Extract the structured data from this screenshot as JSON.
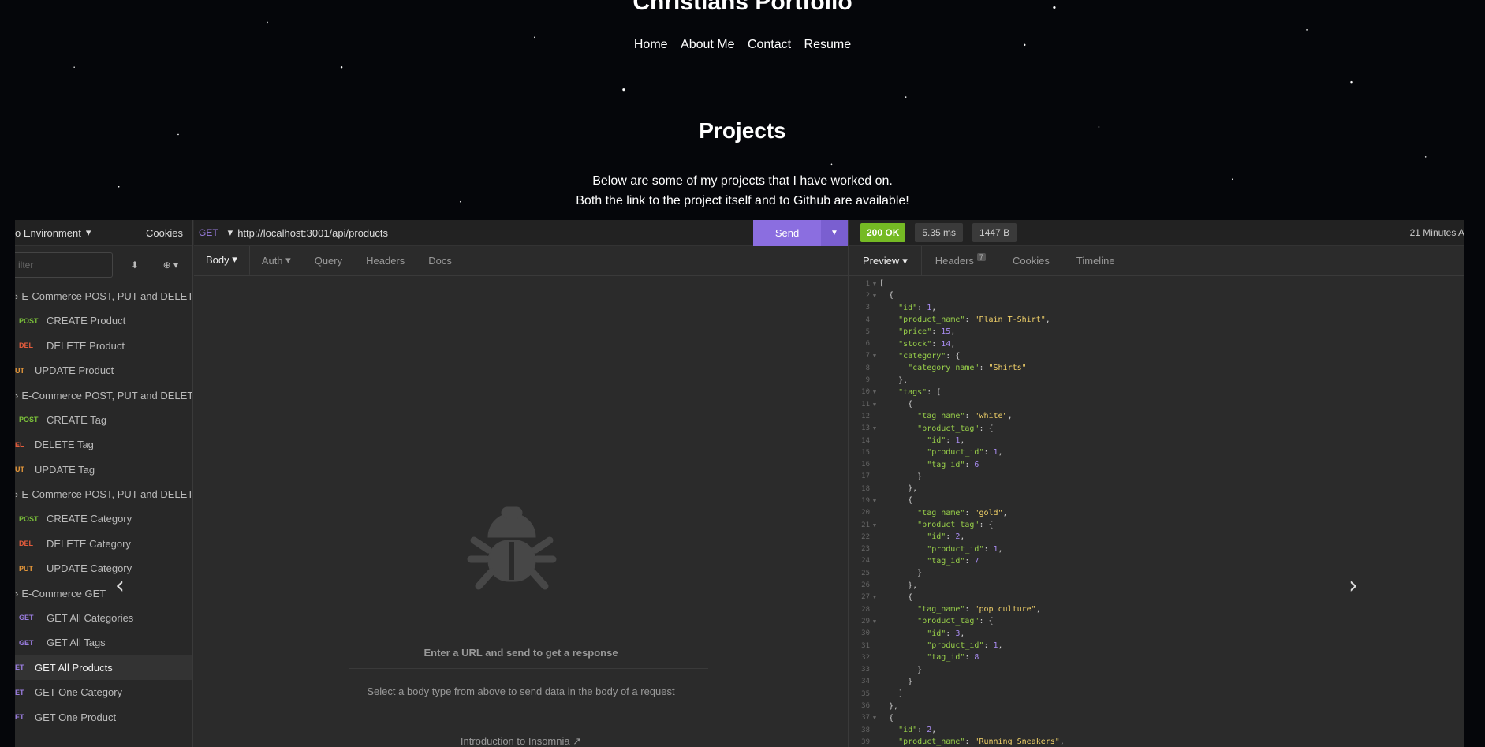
{
  "site": {
    "title": "Christians Portfolio",
    "nav": [
      "Home",
      "About Me",
      "Contact",
      "Resume"
    ],
    "projects_heading": "Projects",
    "desc_line1": "Below are some of my projects that I have worked on.",
    "desc_line2": "Both the link to the project itself and to Github are available!"
  },
  "sidebar": {
    "environment": "o Environment",
    "cookies": "Cookies",
    "filter_placeholder": "ilter",
    "items": [
      {
        "type": "folder",
        "label": "E-Commerce POST, PUT and DELETE..."
      },
      {
        "type": "req",
        "method": "POST",
        "label": "CREATE Product"
      },
      {
        "type": "req",
        "method": "DEL",
        "label": "DELETE Product"
      },
      {
        "type": "req",
        "method": "UT",
        "label": "UPDATE Product",
        "trunc": true
      },
      {
        "type": "folder",
        "label": "E-Commerce POST, PUT and DELETE..."
      },
      {
        "type": "req",
        "method": "POST",
        "label": "CREATE Tag"
      },
      {
        "type": "req",
        "method": "EL",
        "label": "DELETE Tag",
        "trunc": true
      },
      {
        "type": "req",
        "method": "UT",
        "label": "UPDATE Tag",
        "trunc": true
      },
      {
        "type": "folder",
        "label": "E-Commerce POST, PUT and DELETE..."
      },
      {
        "type": "req",
        "method": "POST",
        "label": "CREATE Category"
      },
      {
        "type": "req",
        "method": "DEL",
        "label": "DELETE Category"
      },
      {
        "type": "req",
        "method": "PUT",
        "label": "UPDATE Category"
      },
      {
        "type": "folder",
        "label": "E-Commerce GET"
      },
      {
        "type": "req",
        "method": "GET",
        "label": "GET All Categories"
      },
      {
        "type": "req",
        "method": "GET",
        "label": "GET All Tags"
      },
      {
        "type": "req",
        "method": "ET",
        "label": "GET All Products",
        "trunc": true,
        "active": true
      },
      {
        "type": "req",
        "method": "ET",
        "label": "GET One Category",
        "trunc": true
      },
      {
        "type": "req",
        "method": "ET",
        "label": "GET One Product",
        "trunc": true
      }
    ]
  },
  "request": {
    "method": "GET",
    "url": "http://localhost:3001/api/products",
    "send": "Send",
    "tabs": [
      "Body",
      "Auth",
      "Query",
      "Headers",
      "Docs"
    ],
    "empty_title": "Enter a URL and send to get a response",
    "empty_sub": "Select a body type from above to send data in the body of a request",
    "intro_link": "Introduction to Insomnia"
  },
  "response": {
    "status": "200 OK",
    "time": "5.35 ms",
    "size": "1447 B",
    "age": "21 Minutes A",
    "tabs": [
      "Preview",
      "Headers",
      "Cookies",
      "Timeline"
    ],
    "headers_count": "7",
    "lines": [
      [
        {
          "t": "p",
          "v": "["
        }
      ],
      [
        {
          "t": "p",
          "v": "  {"
        }
      ],
      [
        {
          "t": "k",
          "v": "    \"id\""
        },
        {
          "t": "p",
          "v": ": "
        },
        {
          "t": "n",
          "v": "1"
        },
        {
          "t": "p",
          "v": ","
        }
      ],
      [
        {
          "t": "k",
          "v": "    \"product_name\""
        },
        {
          "t": "p",
          "v": ": "
        },
        {
          "t": "s",
          "v": "\"Plain T-Shirt\""
        },
        {
          "t": "p",
          "v": ","
        }
      ],
      [
        {
          "t": "k",
          "v": "    \"price\""
        },
        {
          "t": "p",
          "v": ": "
        },
        {
          "t": "n",
          "v": "15"
        },
        {
          "t": "p",
          "v": ","
        }
      ],
      [
        {
          "t": "k",
          "v": "    \"stock\""
        },
        {
          "t": "p",
          "v": ": "
        },
        {
          "t": "n",
          "v": "14"
        },
        {
          "t": "p",
          "v": ","
        }
      ],
      [
        {
          "t": "k",
          "v": "    \"category\""
        },
        {
          "t": "p",
          "v": ": {"
        }
      ],
      [
        {
          "t": "k",
          "v": "      \"category_name\""
        },
        {
          "t": "p",
          "v": ": "
        },
        {
          "t": "s",
          "v": "\"Shirts\""
        }
      ],
      [
        {
          "t": "p",
          "v": "    },"
        }
      ],
      [
        {
          "t": "k",
          "v": "    \"tags\""
        },
        {
          "t": "p",
          "v": ": ["
        }
      ],
      [
        {
          "t": "p",
          "v": "      {"
        }
      ],
      [
        {
          "t": "k",
          "v": "        \"tag_name\""
        },
        {
          "t": "p",
          "v": ": "
        },
        {
          "t": "s",
          "v": "\"white\""
        },
        {
          "t": "p",
          "v": ","
        }
      ],
      [
        {
          "t": "k",
          "v": "        \"product_tag\""
        },
        {
          "t": "p",
          "v": ": {"
        }
      ],
      [
        {
          "t": "k",
          "v": "          \"id\""
        },
        {
          "t": "p",
          "v": ": "
        },
        {
          "t": "n",
          "v": "1"
        },
        {
          "t": "p",
          "v": ","
        }
      ],
      [
        {
          "t": "k",
          "v": "          \"product_id\""
        },
        {
          "t": "p",
          "v": ": "
        },
        {
          "t": "n",
          "v": "1"
        },
        {
          "t": "p",
          "v": ","
        }
      ],
      [
        {
          "t": "k",
          "v": "          \"tag_id\""
        },
        {
          "t": "p",
          "v": ": "
        },
        {
          "t": "n",
          "v": "6"
        }
      ],
      [
        {
          "t": "p",
          "v": "        }"
        }
      ],
      [
        {
          "t": "p",
          "v": "      },"
        }
      ],
      [
        {
          "t": "p",
          "v": "      {"
        }
      ],
      [
        {
          "t": "k",
          "v": "        \"tag_name\""
        },
        {
          "t": "p",
          "v": ": "
        },
        {
          "t": "s",
          "v": "\"gold\""
        },
        {
          "t": "p",
          "v": ","
        }
      ],
      [
        {
          "t": "k",
          "v": "        \"product_tag\""
        },
        {
          "t": "p",
          "v": ": {"
        }
      ],
      [
        {
          "t": "k",
          "v": "          \"id\""
        },
        {
          "t": "p",
          "v": ": "
        },
        {
          "t": "n",
          "v": "2"
        },
        {
          "t": "p",
          "v": ","
        }
      ],
      [
        {
          "t": "k",
          "v": "          \"product_id\""
        },
        {
          "t": "p",
          "v": ": "
        },
        {
          "t": "n",
          "v": "1"
        },
        {
          "t": "p",
          "v": ","
        }
      ],
      [
        {
          "t": "k",
          "v": "          \"tag_id\""
        },
        {
          "t": "p",
          "v": ": "
        },
        {
          "t": "n",
          "v": "7"
        }
      ],
      [
        {
          "t": "p",
          "v": "        }"
        }
      ],
      [
        {
          "t": "p",
          "v": "      },"
        }
      ],
      [
        {
          "t": "p",
          "v": "      {"
        }
      ],
      [
        {
          "t": "k",
          "v": "        \"tag_name\""
        },
        {
          "t": "p",
          "v": ": "
        },
        {
          "t": "s",
          "v": "\"pop culture\""
        },
        {
          "t": "p",
          "v": ","
        }
      ],
      [
        {
          "t": "k",
          "v": "        \"product_tag\""
        },
        {
          "t": "p",
          "v": ": {"
        }
      ],
      [
        {
          "t": "k",
          "v": "          \"id\""
        },
        {
          "t": "p",
          "v": ": "
        },
        {
          "t": "n",
          "v": "3"
        },
        {
          "t": "p",
          "v": ","
        }
      ],
      [
        {
          "t": "k",
          "v": "          \"product_id\""
        },
        {
          "t": "p",
          "v": ": "
        },
        {
          "t": "n",
          "v": "1"
        },
        {
          "t": "p",
          "v": ","
        }
      ],
      [
        {
          "t": "k",
          "v": "          \"tag_id\""
        },
        {
          "t": "p",
          "v": ": "
        },
        {
          "t": "n",
          "v": "8"
        }
      ],
      [
        {
          "t": "p",
          "v": "        }"
        }
      ],
      [
        {
          "t": "p",
          "v": "      }"
        }
      ],
      [
        {
          "t": "p",
          "v": "    ]"
        }
      ],
      [
        {
          "t": "p",
          "v": "  },"
        }
      ],
      [
        {
          "t": "p",
          "v": "  {"
        }
      ],
      [
        {
          "t": "k",
          "v": "    \"id\""
        },
        {
          "t": "p",
          "v": ": "
        },
        {
          "t": "n",
          "v": "2"
        },
        {
          "t": "p",
          "v": ","
        }
      ],
      [
        {
          "t": "k",
          "v": "    \"product_name\""
        },
        {
          "t": "p",
          "v": ": "
        },
        {
          "t": "s",
          "v": "\"Running Sneakers\""
        },
        {
          "t": "p",
          "v": ","
        }
      ]
    ],
    "foldable": [
      1,
      2,
      7,
      10,
      11,
      13,
      19,
      21,
      27,
      29,
      37
    ]
  },
  "carousel": {
    "prev_icon": "chevron-left-icon",
    "next_icon": "chevron-right-icon"
  },
  "colors": {
    "accent": "#8b6ee0",
    "ok": "#75ba24"
  }
}
